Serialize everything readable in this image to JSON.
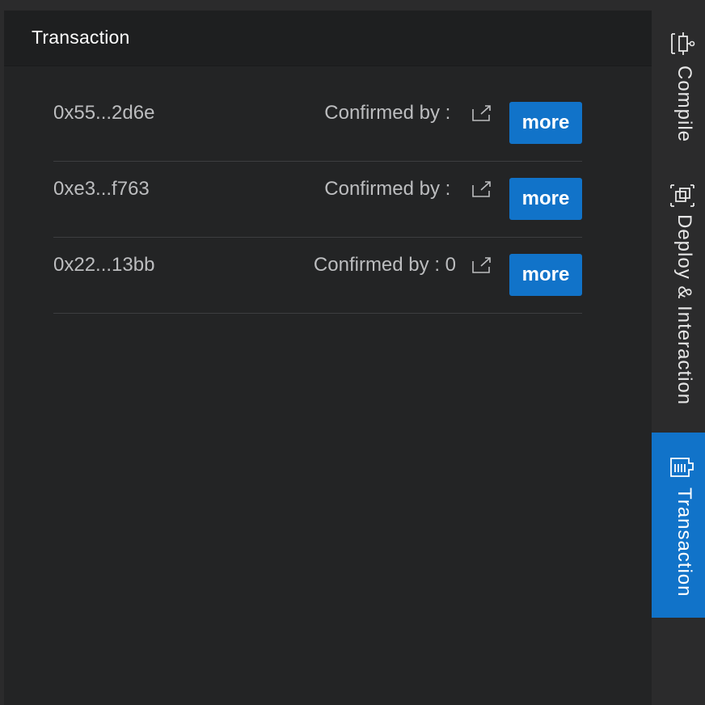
{
  "panel": {
    "title": "Transaction"
  },
  "transactions": [
    {
      "hash": "0x55...2d6e",
      "confirmed": "Confirmed by : ",
      "action": "more"
    },
    {
      "hash": "0xe3...f763",
      "confirmed": "Confirmed by : ",
      "action": "more"
    },
    {
      "hash": "0x22...13bb",
      "confirmed": "Confirmed by : 0",
      "action": "more"
    }
  ],
  "sidebar": {
    "tabs": [
      {
        "label": "Compile",
        "icon": "compile-icon",
        "active": false
      },
      {
        "label": "Deploy & Interaction",
        "icon": "deploy-icon",
        "active": false
      },
      {
        "label": "Transaction",
        "icon": "transaction-icon",
        "active": true
      }
    ]
  },
  "colors": {
    "accent": "#1173c9",
    "panel_bg": "#232425",
    "header_bg": "#1e1f20",
    "text": "#bcbdbf"
  }
}
